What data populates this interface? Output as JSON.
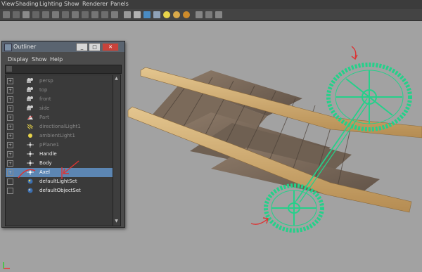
{
  "menubar": {
    "items": [
      "View",
      "Shading",
      "Lighting",
      "Show",
      "Renderer",
      "Panels"
    ]
  },
  "outliner": {
    "title": "Outliner",
    "menu": [
      "Display",
      "Show",
      "Help"
    ],
    "items": [
      {
        "label": "persp",
        "icon": "camera-icon",
        "state": "dim"
      },
      {
        "label": "top",
        "icon": "camera-icon",
        "state": "dim"
      },
      {
        "label": "front",
        "icon": "camera-icon",
        "state": "dim"
      },
      {
        "label": "side",
        "icon": "camera-icon",
        "state": "dim"
      },
      {
        "label": "Part",
        "icon": "part-icon",
        "state": "dim"
      },
      {
        "label": "directionalLight1",
        "icon": "directional-light-icon",
        "state": "dim"
      },
      {
        "label": "ambientLight1",
        "icon": "ambient-light-icon",
        "state": "dim"
      },
      {
        "label": "pPlane1",
        "icon": "transform-icon",
        "state": "dim"
      },
      {
        "label": "Handle",
        "icon": "transform-icon",
        "state": "bright"
      },
      {
        "label": "Body",
        "icon": "transform-icon",
        "state": "bright"
      },
      {
        "label": "Axel",
        "icon": "transform-icon",
        "state": "selected"
      },
      {
        "label": "defaultLightSet",
        "icon": "set-icon",
        "state": "bright"
      },
      {
        "label": "defaultObjectSet",
        "icon": "set-icon",
        "state": "bright"
      }
    ]
  },
  "colors": {
    "selection": "#5c86b3",
    "wireframe": "#25d08a",
    "annotation": "#d33333"
  }
}
